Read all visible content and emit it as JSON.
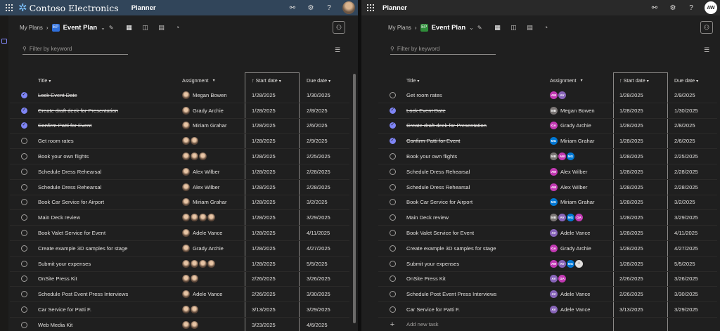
{
  "left": {
    "brand": "Contoso Electronics",
    "app": "Planner",
    "breadcrumb": {
      "root": "My Plans",
      "plan_badge": "EP",
      "plan": "Event Plan"
    },
    "filter_placeholder": "Filter by keyword",
    "columns": {
      "title": "Title",
      "assignment": "Assignment",
      "start": "Start date",
      "due": "Due date"
    },
    "tasks": [
      {
        "title": "Lock Event Date",
        "done": true,
        "people": [
          "Megan Bowen"
        ],
        "label": "Megan Bowen",
        "start": "1/28/2025",
        "due": "1/30/2025"
      },
      {
        "title": "Create draft deck for Presentation",
        "done": true,
        "people": [
          "Grady Archie"
        ],
        "label": "Grady Archie",
        "start": "1/28/2025",
        "due": "2/8/2025"
      },
      {
        "title": "Confirm Patti for Event",
        "done": true,
        "people": [
          "Miriam Graham"
        ],
        "label": "Miriam Grahar",
        "start": "1/28/2025",
        "due": "2/6/2025"
      },
      {
        "title": "Get room rates",
        "done": false,
        "people": [
          "A",
          "B"
        ],
        "label": "",
        "start": "1/28/2025",
        "due": "2/9/2025"
      },
      {
        "title": "Book your own flights",
        "done": false,
        "people": [
          "A",
          "B",
          "C"
        ],
        "label": "",
        "start": "1/28/2025",
        "due": "2/25/2025"
      },
      {
        "title": "Schedule Dress Rehearsal",
        "done": false,
        "people": [
          "Alex Wilber"
        ],
        "label": "Alex Wilber",
        "start": "1/28/2025",
        "due": "2/28/2025"
      },
      {
        "title": "Schedule Dress Rehearsal",
        "done": false,
        "people": [
          "Alex Wilber"
        ],
        "label": "Alex Wilber",
        "start": "1/28/2025",
        "due": "2/28/2025"
      },
      {
        "title": "Book Car Service for Airport",
        "done": false,
        "people": [
          "Miriam Graham"
        ],
        "label": "Miriam Grahar",
        "start": "1/28/2025",
        "due": "3/2/2025"
      },
      {
        "title": "Main Deck review",
        "done": false,
        "people": [
          "A",
          "B",
          "C",
          "D"
        ],
        "label": "",
        "start": "1/28/2025",
        "due": "3/29/2025"
      },
      {
        "title": "Book Valet Service for Event",
        "done": false,
        "people": [
          "Adele Vance"
        ],
        "label": "Adele Vance",
        "start": "1/28/2025",
        "due": "4/11/2025"
      },
      {
        "title": "Create example 3D samples for stage",
        "done": false,
        "people": [
          "Grady Archie"
        ],
        "label": "Grady Archie",
        "start": "1/28/2025",
        "due": "4/27/2025"
      },
      {
        "title": "Submit your expenses",
        "done": false,
        "people": [
          "A",
          "B",
          "C",
          "D"
        ],
        "label": "",
        "start": "1/28/2025",
        "due": "5/5/2025"
      },
      {
        "title": "OnSite Press Kit",
        "done": false,
        "people": [
          "A",
          "B"
        ],
        "label": "",
        "start": "2/26/2025",
        "due": "3/26/2025"
      },
      {
        "title": "Schedule Post Event Press Interviews",
        "done": false,
        "people": [
          "Adele Vance"
        ],
        "label": "Adele Vance",
        "start": "2/26/2025",
        "due": "3/30/2025"
      },
      {
        "title": "Car Service for Patti F.",
        "done": false,
        "people": [
          "A",
          "B"
        ],
        "label": "",
        "start": "3/13/2025",
        "due": "3/29/2025"
      },
      {
        "title": "Web Media Kit",
        "done": false,
        "people": [
          "A",
          "B"
        ],
        "label": "",
        "start": "3/23/2025",
        "due": "4/6/2025"
      }
    ]
  },
  "right": {
    "app": "Planner",
    "me_initials": "AW",
    "breadcrumb": {
      "root": "My Plans",
      "plan_badge": "EP",
      "plan": "Event Plan"
    },
    "filter_placeholder": "Filter by keyword",
    "columns": {
      "title": "Title",
      "assignment": "Assignment",
      "start": "Start date",
      "due": "Due date"
    },
    "add_task": "Add new task",
    "tasks": [
      {
        "title": "Get room rates",
        "done": false,
        "avatars": [
          {
            "i": "AW",
            "c": "#c239b3"
          },
          {
            "i": "AV",
            "c": "#8764b8"
          }
        ],
        "label": "",
        "start": "1/28/2025",
        "due": "2/9/2025"
      },
      {
        "title": "Lock Event Date",
        "done": true,
        "avatars": [
          {
            "i": "MB",
            "c": "#7a7574"
          }
        ],
        "label": "Megan Bowen",
        "start": "1/28/2025",
        "due": "1/30/2025"
      },
      {
        "title": "Create draft deck for Presentation",
        "done": true,
        "avatars": [
          {
            "i": "GA",
            "c": "#c239b3"
          }
        ],
        "label": "Grady Archie",
        "start": "1/28/2025",
        "due": "2/8/2025"
      },
      {
        "title": "Confirm Patti for Event",
        "done": true,
        "avatars": [
          {
            "i": "MG",
            "c": "#0078d4"
          }
        ],
        "label": "Miriam Grahar",
        "start": "1/28/2025",
        "due": "2/6/2025"
      },
      {
        "title": "Book your own flights",
        "done": false,
        "avatars": [
          {
            "i": "MB",
            "c": "#7a7574"
          },
          {
            "i": "AW",
            "c": "#c239b3"
          },
          {
            "i": "MG",
            "c": "#0078d4"
          }
        ],
        "label": "",
        "start": "1/28/2025",
        "due": "2/25/2025"
      },
      {
        "title": "Schedule Dress Rehearsal",
        "done": false,
        "avatars": [
          {
            "i": "AW",
            "c": "#c239b3"
          }
        ],
        "label": "Alex Wilber",
        "start": "1/28/2025",
        "due": "2/28/2025"
      },
      {
        "title": "Schedule Dress Rehearsal",
        "done": false,
        "avatars": [
          {
            "i": "AW",
            "c": "#c239b3"
          }
        ],
        "label": "Alex Wilber",
        "start": "1/28/2025",
        "due": "2/28/2025"
      },
      {
        "title": "Book Car Service for Airport",
        "done": false,
        "avatars": [
          {
            "i": "MG",
            "c": "#0078d4"
          }
        ],
        "label": "Miriam Grahar",
        "start": "1/28/2025",
        "due": "3/2/2025"
      },
      {
        "title": "Main Deck review",
        "done": false,
        "avatars": [
          {
            "i": "MB",
            "c": "#7a7574"
          },
          {
            "i": "AV",
            "c": "#8764b8"
          },
          {
            "i": "MG",
            "c": "#0078d4"
          },
          {
            "i": "GA",
            "c": "#c239b3"
          }
        ],
        "label": "",
        "start": "1/28/2025",
        "due": "3/29/2025"
      },
      {
        "title": "Book Valet Service for Event",
        "done": false,
        "avatars": [
          {
            "i": "AV",
            "c": "#8764b8"
          }
        ],
        "label": "Adele Vance",
        "start": "1/28/2025",
        "due": "4/11/2025"
      },
      {
        "title": "Create example 3D samples for stage",
        "done": false,
        "avatars": [
          {
            "i": "GA",
            "c": "#c239b3"
          }
        ],
        "label": "Grady Archie",
        "start": "1/28/2025",
        "due": "4/27/2025"
      },
      {
        "title": "Submit your expenses",
        "done": false,
        "avatars": [
          {
            "i": "AW",
            "c": "#c239b3"
          },
          {
            "i": "AV",
            "c": "#8764b8"
          },
          {
            "i": "MG",
            "c": "#0078d4"
          },
          {
            "i": "",
            "c": "#e1dfdd"
          }
        ],
        "label": "",
        "start": "1/28/2025",
        "due": "5/5/2025"
      },
      {
        "title": "OnSite Press Kit",
        "done": false,
        "avatars": [
          {
            "i": "AV",
            "c": "#8764b8"
          },
          {
            "i": "GA",
            "c": "#c239b3"
          }
        ],
        "label": "",
        "start": "2/26/2025",
        "due": "3/26/2025"
      },
      {
        "title": "Schedule Post Event Press Interviews",
        "done": false,
        "avatars": [
          {
            "i": "AV",
            "c": "#8764b8"
          }
        ],
        "label": "Adele Vance",
        "start": "2/26/2025",
        "due": "3/30/2025"
      },
      {
        "title": "Car Service for Patti F.",
        "done": false,
        "avatars": [
          {
            "i": "AV",
            "c": "#8764b8"
          }
        ],
        "label": "Adele Vance",
        "start": "3/13/2025",
        "due": "3/29/2025"
      }
    ]
  }
}
